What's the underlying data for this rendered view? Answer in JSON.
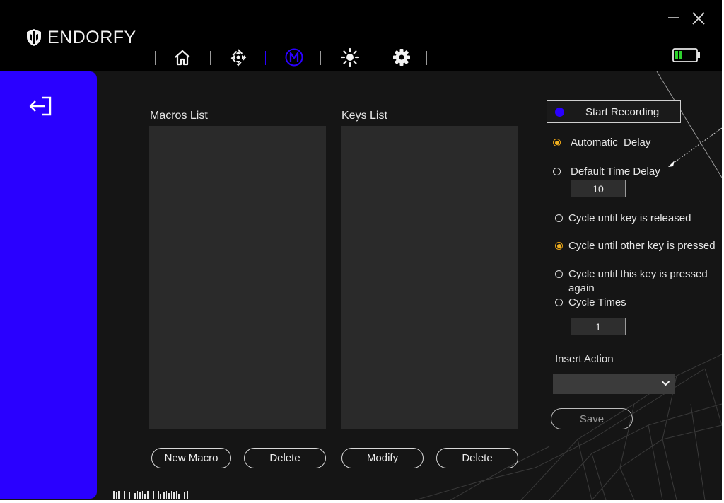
{
  "app": {
    "brand": "ENDORFY"
  },
  "nav": {
    "items": [
      {
        "name": "home-icon",
        "active": false
      },
      {
        "name": "dpad-icon",
        "active": false
      },
      {
        "name": "macro-icon",
        "active": true
      },
      {
        "name": "lighting-icon",
        "active": false
      },
      {
        "name": "settings-icon",
        "active": false
      }
    ]
  },
  "colors": {
    "accent": "#2a00ff",
    "selected_radio": "#f0b020",
    "panel": "#2a2a2a",
    "background": "#151515"
  },
  "macros_list": {
    "title": "Macros List",
    "new_label": "New Macro",
    "delete_label": "Delete"
  },
  "keys_list": {
    "title": "Keys List",
    "modify_label": "Modify",
    "delete_label": "Delete"
  },
  "recording": {
    "label": "Start Recording"
  },
  "delay": {
    "options": [
      {
        "label": "Automatic  Delay",
        "selected": true
      },
      {
        "label": "Default Time Delay",
        "selected": false
      }
    ],
    "default_value": "10"
  },
  "cycle": {
    "options": [
      {
        "label": "Cycle until key is released",
        "selected": false
      },
      {
        "label": "Cycle until other key is pressed",
        "selected": true
      },
      {
        "label": "Cycle until this key is pressed again",
        "selected": false
      },
      {
        "label": "Cycle Times",
        "selected": false
      }
    ],
    "times_value": "1"
  },
  "insert_action": {
    "label": "Insert Action",
    "value": ""
  },
  "save": {
    "label": "Save"
  }
}
